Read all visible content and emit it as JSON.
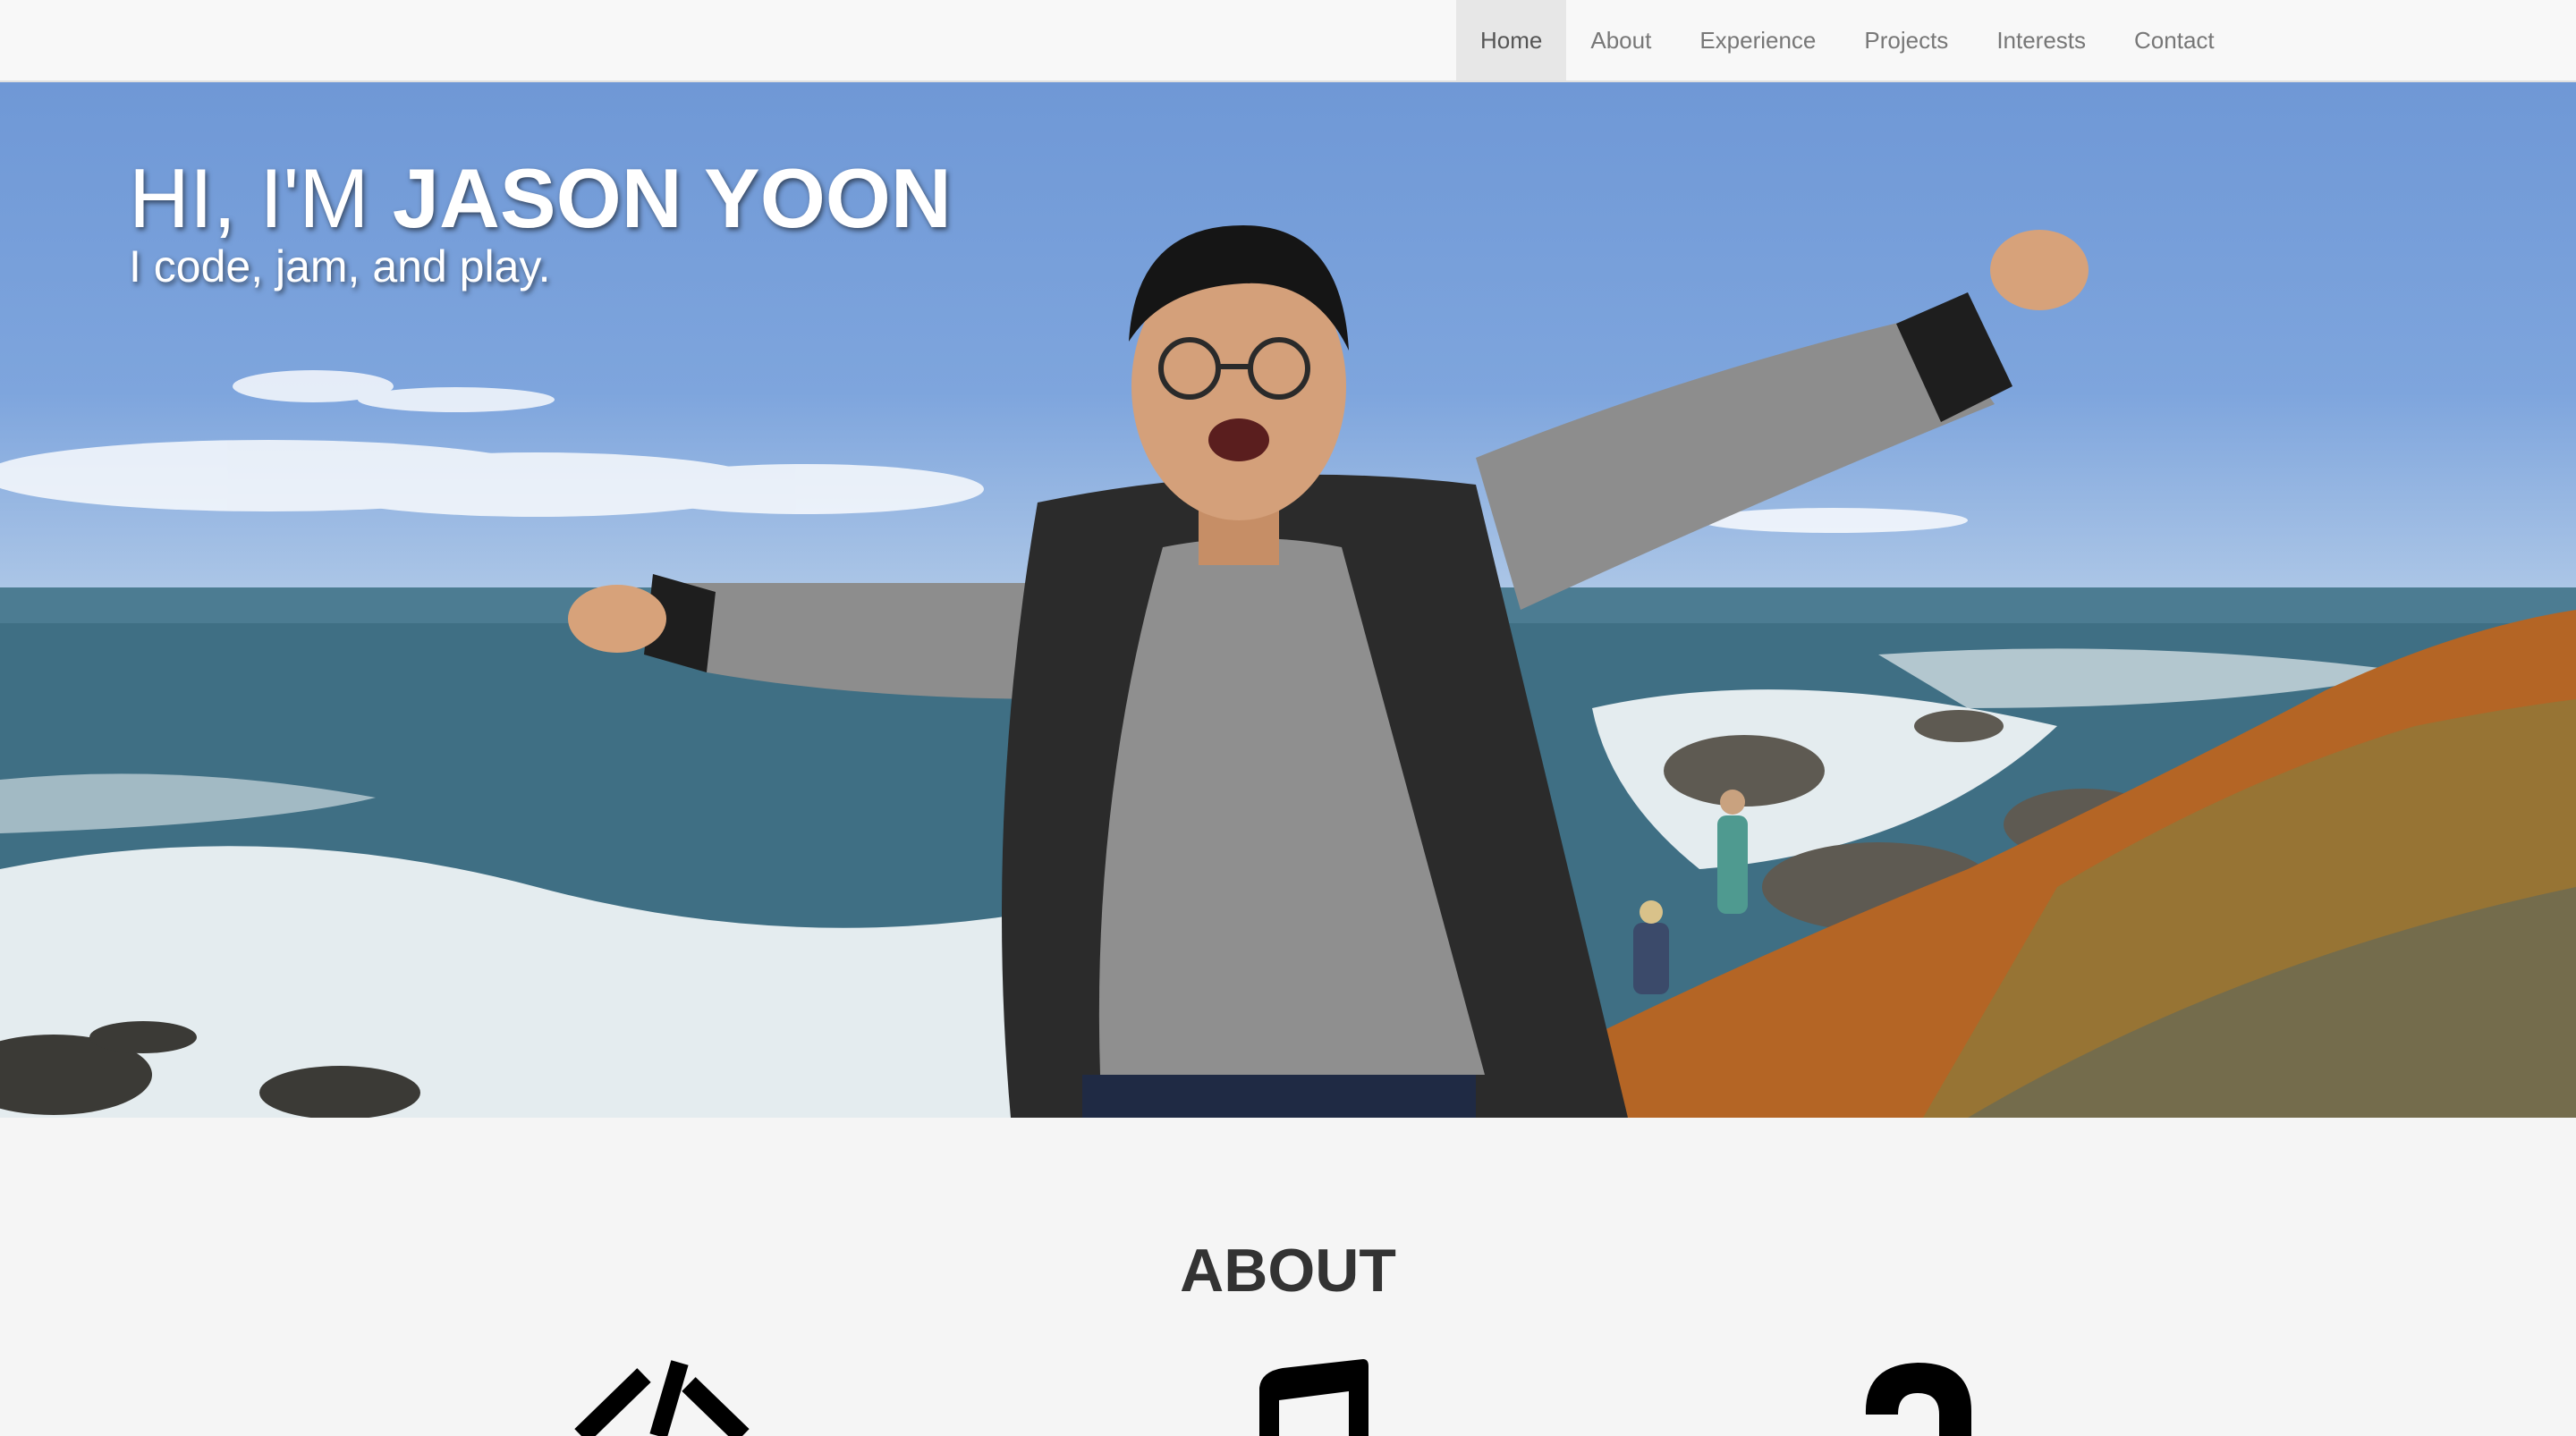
{
  "nav": {
    "items": [
      {
        "label": "Home",
        "active": true
      },
      {
        "label": "About",
        "active": false
      },
      {
        "label": "Experience",
        "active": false
      },
      {
        "label": "Projects",
        "active": false
      },
      {
        "label": "Interests",
        "active": false
      },
      {
        "label": "Contact",
        "active": false
      }
    ]
  },
  "hero": {
    "title_prefix": "HI, I'M ",
    "title_name": "JASON YOON",
    "subtitle": "I code, jam, and play.",
    "image": "hero-photo"
  },
  "about": {
    "heading": "ABOUT",
    "icons": [
      "code-icon",
      "music-note-icon",
      "question-mark-icon"
    ]
  },
  "colors": {
    "navbar_bg": "#f8f8f8",
    "nav_active_bg": "#e7e7e7",
    "nav_text": "#777777",
    "page_bg": "#f5f5f5",
    "heading_text": "#333333"
  }
}
